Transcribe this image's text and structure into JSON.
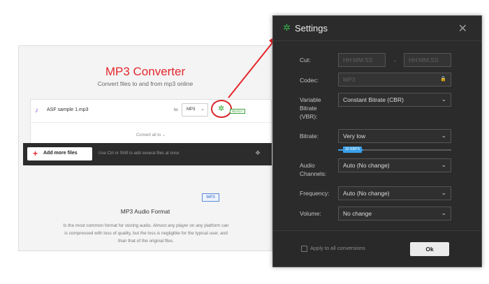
{
  "converter": {
    "title": "MP3 Converter",
    "subtitle": "Convert files to and from mp3 online",
    "file_name": "ASF sample 1.mp3",
    "to_label": "to:",
    "format_value": "MP3",
    "ready_badge": "READY",
    "convert_all_label": "Convert all to",
    "add_more_label": "Add more files",
    "add_hint": "Use Ctrl or Shift to add several files at once",
    "format_tag": "MP3",
    "info_title": "MP3 Audio Format",
    "info_lines": [
      "Is the most common format for storing audio. Almost any player on any platform can",
      "is compressed with loss of quality, but the loss is negligible for the typical user, and",
      "than that of the original files."
    ]
  },
  "settings": {
    "title": "Settings",
    "cut_label": "Cut:",
    "cut_start_placeholder": "HH:MM:SS",
    "cut_end_placeholder": "HH:MM:SS",
    "cut_separator": "-",
    "codec_label": "Codec:",
    "codec_value": "MP3",
    "vbr_label_lines": [
      "Variable",
      "Bitrate",
      "(VBR):"
    ],
    "vbr_value": "Constant Bitrate (CBR)",
    "bitrate_label": "Bitrate:",
    "bitrate_value": "Very low",
    "bitrate_slider_label": "32 KBPS",
    "bitrate_slider_fraction": 0.22,
    "channels_label_lines": [
      "Audio",
      "Channels:"
    ],
    "channels_value": "Auto (No change)",
    "frequency_label": "Frequency:",
    "frequency_value": "Auto (No change)",
    "volume_label": "Volume:",
    "volume_value": "No change",
    "apply_all_label": "Apply to all conversions",
    "ok_label": "Ok"
  },
  "colors": {
    "accent_red": "#e4272c",
    "gear_green": "#35b34a",
    "slider_blue": "#3aa0ea",
    "modal_bg": "#2b2b2b"
  }
}
